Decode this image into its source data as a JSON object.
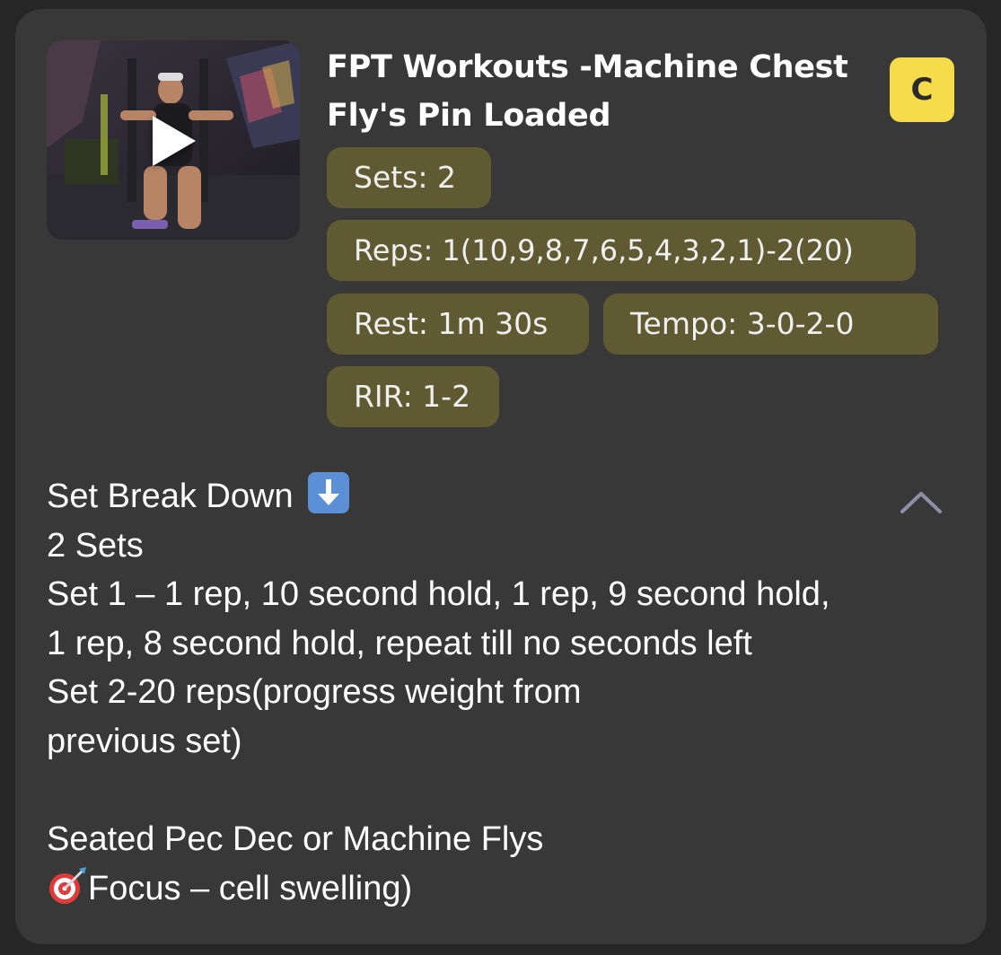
{
  "workout": {
    "title": "FPT Workouts -Machine Chest Fly's Pin Loaded",
    "grade": "C",
    "thumbnail_icon": "play-icon",
    "stats": {
      "sets": "Sets: 2",
      "reps": "Reps: 1(10,9,8,7,6,5,4,3,2,1)-2(20)",
      "rest": "Rest: 1m 30s",
      "tempo": "Tempo: 3-0-2-0",
      "rir": "RIR: 1-2"
    }
  },
  "description": {
    "heading": "Set Break Down",
    "heading_icon": "down-arrow-icon",
    "lines": [
      "2 Sets",
      "Set 1 – 1 rep, 10 second hold, 1 rep, 9 second hold,",
      "1 rep, 8 second hold, repeat till no seconds left",
      "Set 2-20 reps(progress weight from",
      "previous set)",
      "",
      "Seated Pec Dec or Machine Flys"
    ],
    "focus_icon": "target-icon",
    "focus_text": "Focus – cell swelling)"
  },
  "collapse_icon": "chevron-up-icon",
  "colors": {
    "background": "#262626",
    "card": "#383838",
    "pill": "#605a32",
    "grade_badge": "#f6dc4a"
  }
}
